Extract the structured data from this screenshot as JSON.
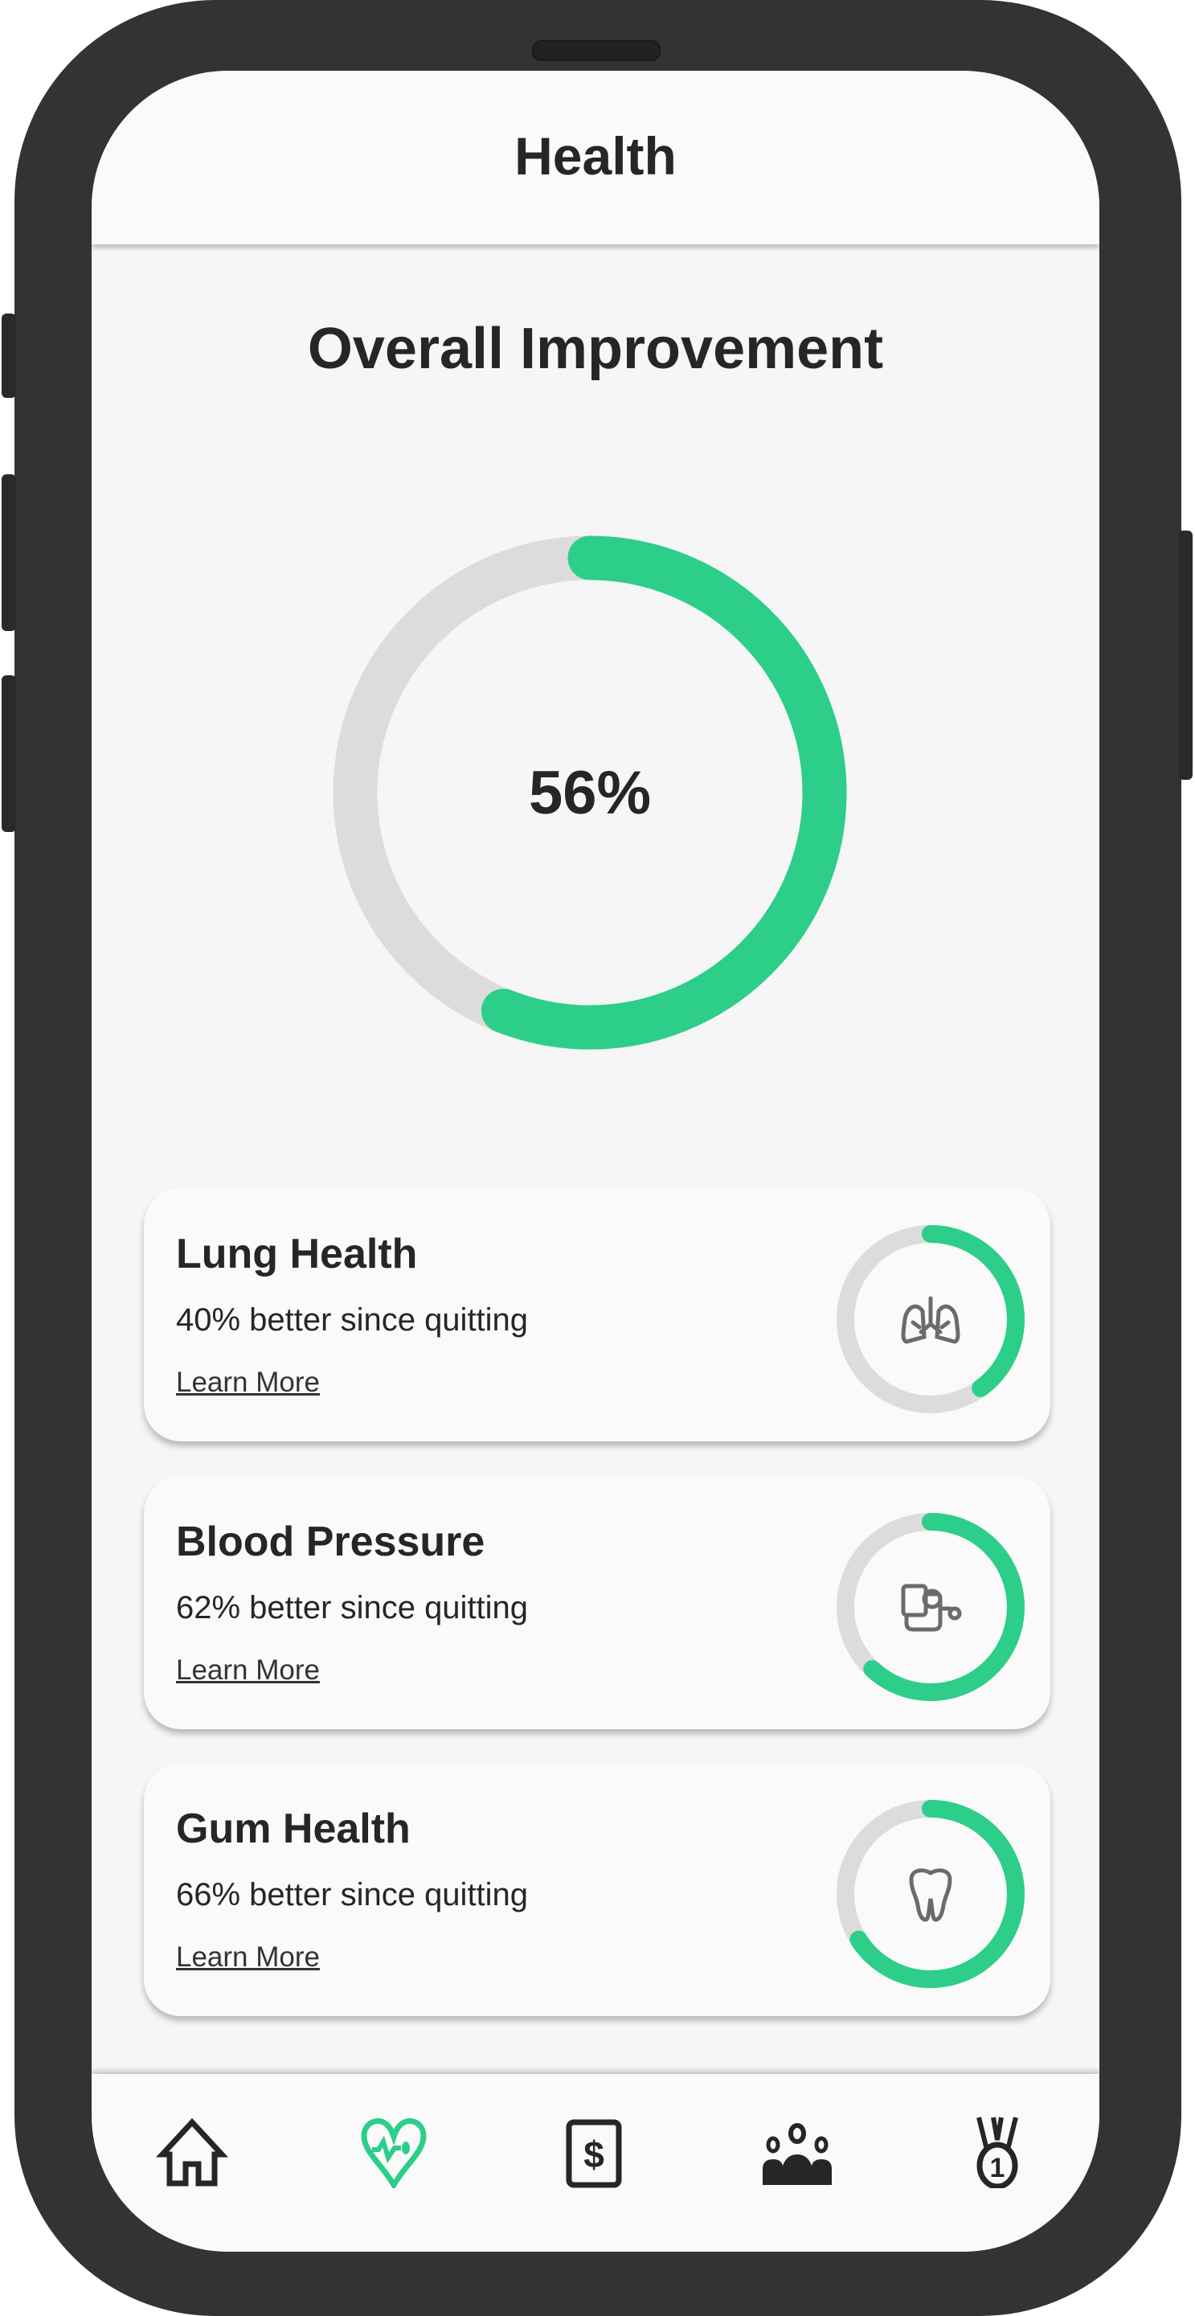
{
  "header": {
    "title": "Health"
  },
  "overall": {
    "title": "Overall Improvement",
    "percent": 56,
    "label": "56%"
  },
  "colors": {
    "accent": "#2dce89",
    "track": "#dcdcdc",
    "icon": "#6b6b6b",
    "dark": "#262626"
  },
  "cards": [
    {
      "title": "Lung Health",
      "subtitle": "40% better since quitting",
      "link": "Learn More",
      "percent": 40,
      "icon": "lungs-icon"
    },
    {
      "title": "Blood Pressure",
      "subtitle": "62% better since quitting",
      "link": "Learn More",
      "percent": 62,
      "icon": "blood-pressure-icon"
    },
    {
      "title": "Gum Health",
      "subtitle": "66% better since quitting",
      "link": "Learn More",
      "percent": 66,
      "icon": "tooth-icon"
    }
  ],
  "nav": [
    {
      "name": "home-icon",
      "active": false
    },
    {
      "name": "heart-pulse-icon",
      "active": true
    },
    {
      "name": "money-icon",
      "active": false
    },
    {
      "name": "community-icon",
      "active": false
    },
    {
      "name": "medal-icon",
      "active": false
    }
  ]
}
